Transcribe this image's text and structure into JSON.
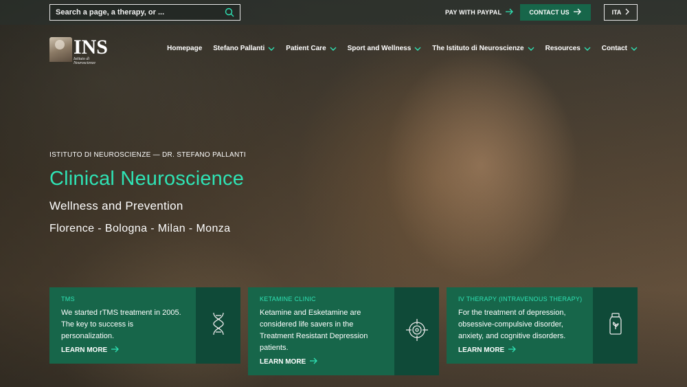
{
  "topbar": {
    "search_placeholder": "Search a page, a therapy, or ...",
    "paypal_label": "PAY WITH PAYPAL",
    "contact_label": "CONTACT US",
    "lang_label": "ITA"
  },
  "logo": {
    "main": "INS",
    "sub": "Istituto di Neuroscienze"
  },
  "nav": {
    "items": [
      {
        "label": "Homepage"
      },
      {
        "label": "Stefano Pallanti"
      },
      {
        "label": "Patient Care"
      },
      {
        "label": "Sport and Wellness"
      },
      {
        "label": "The Istituto di Neuroscienze"
      },
      {
        "label": "Resources"
      },
      {
        "label": "Contact"
      }
    ]
  },
  "hero": {
    "eyebrow": "ISTITUTO DI NEUROSCIENZE — DR. STEFANO PALLANTI",
    "title": "Clinical Neuroscience",
    "subtitle": "Wellness and Prevention",
    "cities": "Florence - Bologna - Milan - Monza"
  },
  "cards": [
    {
      "tag": "TMS",
      "text": "We started rTMS treatment in 2005. The key to success is personalization.",
      "link": "LEARN MORE",
      "icon": "dna-icon"
    },
    {
      "tag": "KETAMINE CLINIC",
      "text": "Ketamine and Esketamine are considered life savers in the Treatment Resistant Depression patients.",
      "link": "LEARN MORE",
      "icon": "target-icon"
    },
    {
      "tag": "IV THERAPY (INTRAVENOUS THERAPY)",
      "text": "For the treatment of depression, obsessive-compulsive disorder, anxiety, and cognitive disorders.",
      "link": "LEARN MORE",
      "icon": "medicine-jar-icon"
    }
  ],
  "colors": {
    "accent": "#2fe3b5",
    "brand_green": "#17664a",
    "brand_green_dark": "#0f4a38"
  }
}
